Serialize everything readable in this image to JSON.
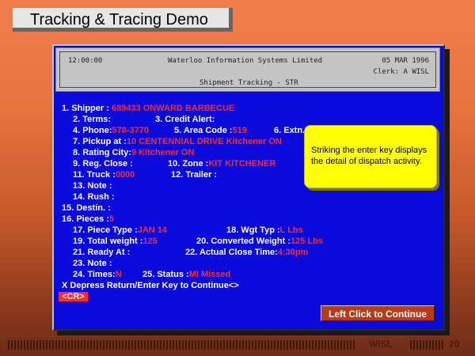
{
  "slide": {
    "title": "Tracking & Tracing Demo"
  },
  "header": {
    "time": "12:00:00",
    "company": "Waterloo Information Systems Limited",
    "date": "05 MAR 1996",
    "clerk": "Clerk: A WISL",
    "screen_title": "Shipment Tracking - STR"
  },
  "form": {
    "shipper_label": "1. Shipper :",
    "shipper_value": "689433 ONWARD BARBECUE",
    "terms_label": "2. Terms:",
    "credit_alert_label": "3. Credit Alert:",
    "phone_label": "4. Phone:",
    "phone_value": "578-3770",
    "area_code_label": "5. Area Code :",
    "area_code_value": "519",
    "extn_label": "6. Extn.",
    "pickup_label": "7. Pickup at :",
    "pickup_value": "10 CENTENNIAL DRIVE Kitchener ON",
    "rating_city_label": "8. Rating City:",
    "rating_city_value": "9 Kitchener ON",
    "reg_close_label": "9. Reg. Close :",
    "zone_label": "10. Zone :",
    "zone_value": "KIT KITCHENER",
    "truck_label": "11. Truck :",
    "truck_value": "0000",
    "trailer_label": "12. Trailer :",
    "note1_label": "13. Note :",
    "rush_label": "14. Rush :",
    "destin_label": "15. Destin. :",
    "pieces_label": "16. Pieces :",
    "pieces_value": "5",
    "piece_type_label": "17. Piece Type :",
    "piece_type_value": "JAN 14",
    "wgt_typ_label": "18. Wgt Typ :",
    "wgt_typ_value": "L Lbs",
    "total_weight_label": "19. Total weight :",
    "total_weight_value": "125",
    "converted_weight_label": "20. Converted Weight :",
    "converted_weight_value": "125 Lbs",
    "ready_at_label": "21. Ready At :",
    "actual_close_label": "22. Actual Close Time:",
    "actual_close_value": "4:30pm",
    "note2_label": "23. Note :",
    "times_label": "24. Times:",
    "times_value": "N",
    "status_label": "25. Status :",
    "status_value": "MI Missed",
    "prompt": "X Depress Return/Enter Key to Continue<>",
    "cr_label": "<CR>"
  },
  "callout": {
    "text": "Striking the enter key displays the detail of dispatch activity."
  },
  "continue_button": {
    "label": "Left Click to Continue"
  },
  "footer": {
    "brand": "WISL",
    "page_number": "20"
  }
}
